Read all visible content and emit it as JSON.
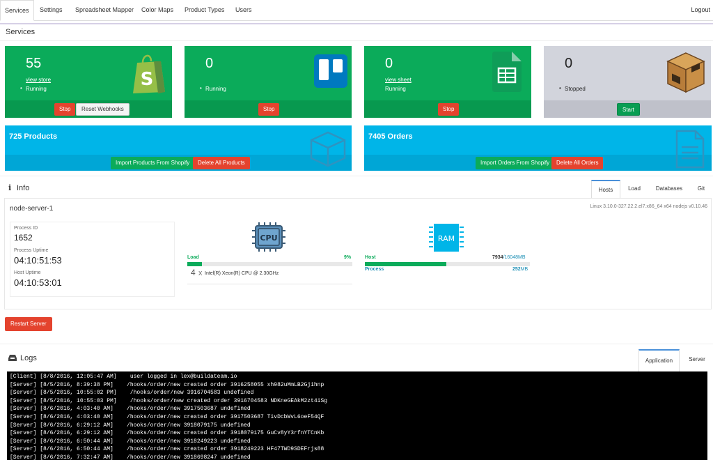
{
  "nav": {
    "tabs": [
      "Services",
      "Settings",
      "Spreadsheet Mapper",
      "Color Maps",
      "Product Types",
      "Users"
    ],
    "logout": "Logout"
  },
  "page_title": "Services",
  "cards": [
    {
      "count": "55",
      "link": "view store",
      "status": "Running",
      "buttons": [
        "Stop",
        "Reset Webhooks"
      ],
      "icon": "shopify-bag-icon"
    },
    {
      "count": "0",
      "status": "Running",
      "buttons": [
        "Stop"
      ],
      "icon": "trello-icon"
    },
    {
      "count": "0",
      "link": "view sheet",
      "status": "Running",
      "buttons": [
        "Stop"
      ],
      "icon": "google-sheets-icon"
    },
    {
      "count": "0",
      "status": "Stopped",
      "buttons": [
        "Start"
      ],
      "icon": "package-box-icon"
    }
  ],
  "products": {
    "title": "725 Products",
    "import": "Import Products From Shopify",
    "delete": "Delete All Products"
  },
  "orders": {
    "title": "7405 Orders",
    "import": "Import Orders From Shopify",
    "delete": "Delete All Orders"
  },
  "info": {
    "title": "Info",
    "tabs": [
      "Hosts",
      "Load",
      "Databases",
      "Git"
    ],
    "server_name": "node-server-1",
    "server_meta": "Linux 3.10.0-327.22.2.el7.x86_64 x64 nodejs v0.10.46",
    "process_id_label": "Process ID",
    "process_id": "1652",
    "process_uptime_label": "Process Uptime",
    "process_uptime": "04:10:51:53",
    "host_uptime_label": "Host Uptime",
    "host_uptime": "04:10:53:01",
    "cpu_chip": "CPU",
    "ram_chip": "RAM",
    "load_label": "Load",
    "load_value": "9%",
    "load_fraction": 0.09,
    "cpu_count": "4",
    "cpu_x": "X",
    "cpu_model": "Intel(R) Xeon(R) CPU @ 2.30GHz",
    "host_label": "Host",
    "host_used": "7934",
    "host_total": "/16048MB",
    "host_fraction": 0.494,
    "process_label": "Process",
    "process_mem": "252",
    "process_unit": "MB"
  },
  "restart_button": "Restart Server",
  "logs": {
    "title": "Logs",
    "tabs": [
      "Application",
      "Server"
    ],
    "lines": [
      "[Client] [8/8/2016, 12:05:47 AM]    user logged in lex@buildateam.io",
      "[Server] [8/5/2016, 8:39:38 PM]    /hooks/order/new created order 3916258055 xh982uMmLB2Gjihnp",
      "[Server] [8/5/2016, 10:55:02 PM]    /hooks/order/new 3916704583 undefined",
      "[Server] [8/5/2016, 10:55:03 PM]    /hooks/order/new created order 3916704583 NDKneGEAkM2zt4iSg",
      "[Server] [8/6/2016, 4:03:40 AM]    /hooks/order/new 3917503687 undefined",
      "[Server] [8/6/2016, 4:03:40 AM]    /hooks/order/new created order 3917503687 TivDcbWvL6oeF54QF",
      "[Server] [8/6/2016, 6:29:12 AM]    /hooks/order/new 3918079175 undefined",
      "[Server] [8/6/2016, 6:29:12 AM]    /hooks/order/new created order 3918079175 GuCv8yY3rfnYTCnKb",
      "[Server] [8/6/2016, 6:50:44 AM]    /hooks/order/new 3918249223 undefined",
      "[Server] [8/6/2016, 6:50:44 AM]    /hooks/order/new created order 3918249223 HF47TWD9SDEFrjs88",
      "[Server] [8/6/2016, 7:32:47 AM]    /hooks/order/new 3918698247 undefined"
    ]
  },
  "colors": {
    "green": "#0bab5a",
    "blue": "#00b5e8",
    "red": "#e4432e",
    "grey": "#d2d4dc"
  }
}
